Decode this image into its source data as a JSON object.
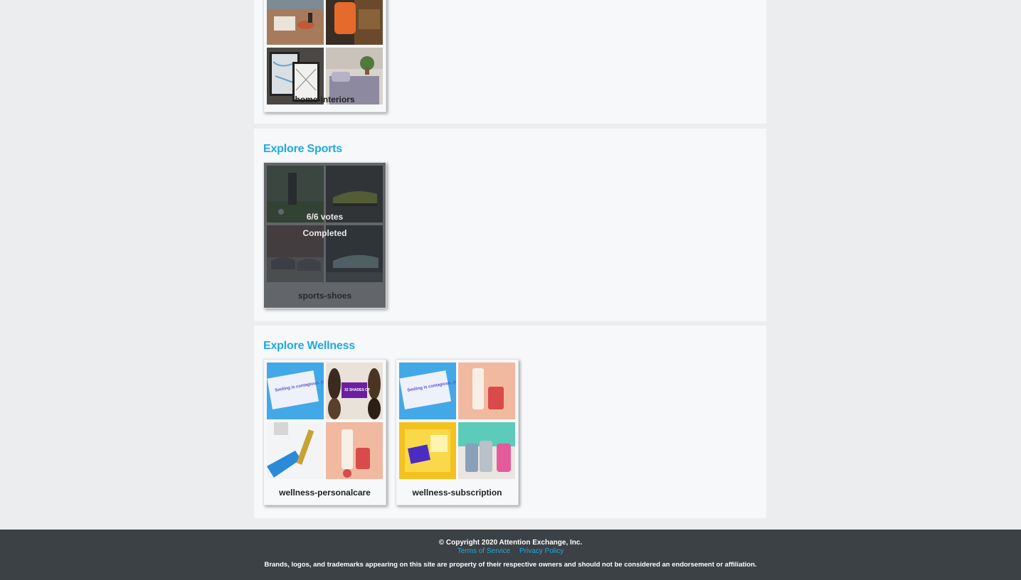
{
  "sections": {
    "home": {
      "card_label": "home-interiors"
    },
    "sports": {
      "title": "Explore Sports",
      "card_label": "sports-shoes",
      "votes": "6/6 votes",
      "status": "Completed"
    },
    "wellness": {
      "title": "Explore Wellness",
      "cards": [
        {
          "label": "wellness-personalcare"
        },
        {
          "label": "wellness-subscription"
        }
      ],
      "tile_text": {
        "smile": "Smiling is contagious. join the club.",
        "shades": "32 SHADES OF"
      }
    }
  },
  "footer": {
    "copyright": "© Copyright 2020 Attention Exchange, Inc.",
    "terms": "Terms of Service",
    "privacy": "Privacy Policy",
    "disclaimer": "Brands, logos, and trademarks appearing on this site are property of their respective owners and should not be considered an endorsement or affiliation."
  },
  "colors": {
    "accent": "#1eaae1",
    "footer_bg": "#3c4145",
    "page_bg": "#ebedef",
    "section_bg": "#f6f8fa"
  }
}
